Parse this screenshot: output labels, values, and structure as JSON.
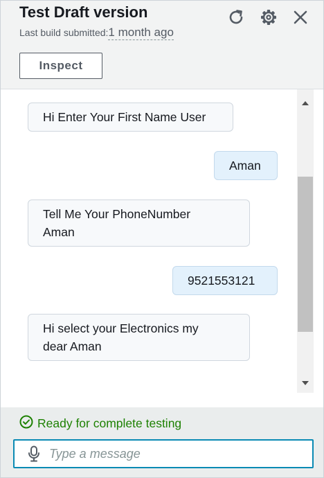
{
  "header": {
    "title": "Test Draft version",
    "build_label": "Last build submitted:",
    "build_time": "1 month ago",
    "inspect_label": "Inspect",
    "icons": [
      "refresh-icon",
      "gear-icon",
      "close-icon"
    ]
  },
  "messages": [
    {
      "sender": "bot",
      "lines": [
        "Hi Enter Your First Name User"
      ]
    },
    {
      "sender": "user",
      "lines": [
        "Aman"
      ]
    },
    {
      "sender": "bot",
      "lines": [
        "Tell Me Your PhoneNumber",
        "Aman"
      ]
    },
    {
      "sender": "user",
      "lines": [
        "9521553121"
      ]
    },
    {
      "sender": "bot",
      "lines": [
        "Hi select your Electronics my",
        "dear Aman"
      ]
    }
  ],
  "footer": {
    "status": "Ready for complete testing",
    "input_placeholder": "Type a message",
    "input_value": ""
  },
  "colors": {
    "status_green": "#1d8102",
    "input_border": "#0a8ab4",
    "bot_bubble": "#f7f9fb",
    "user_bubble": "#e3f1fc"
  }
}
